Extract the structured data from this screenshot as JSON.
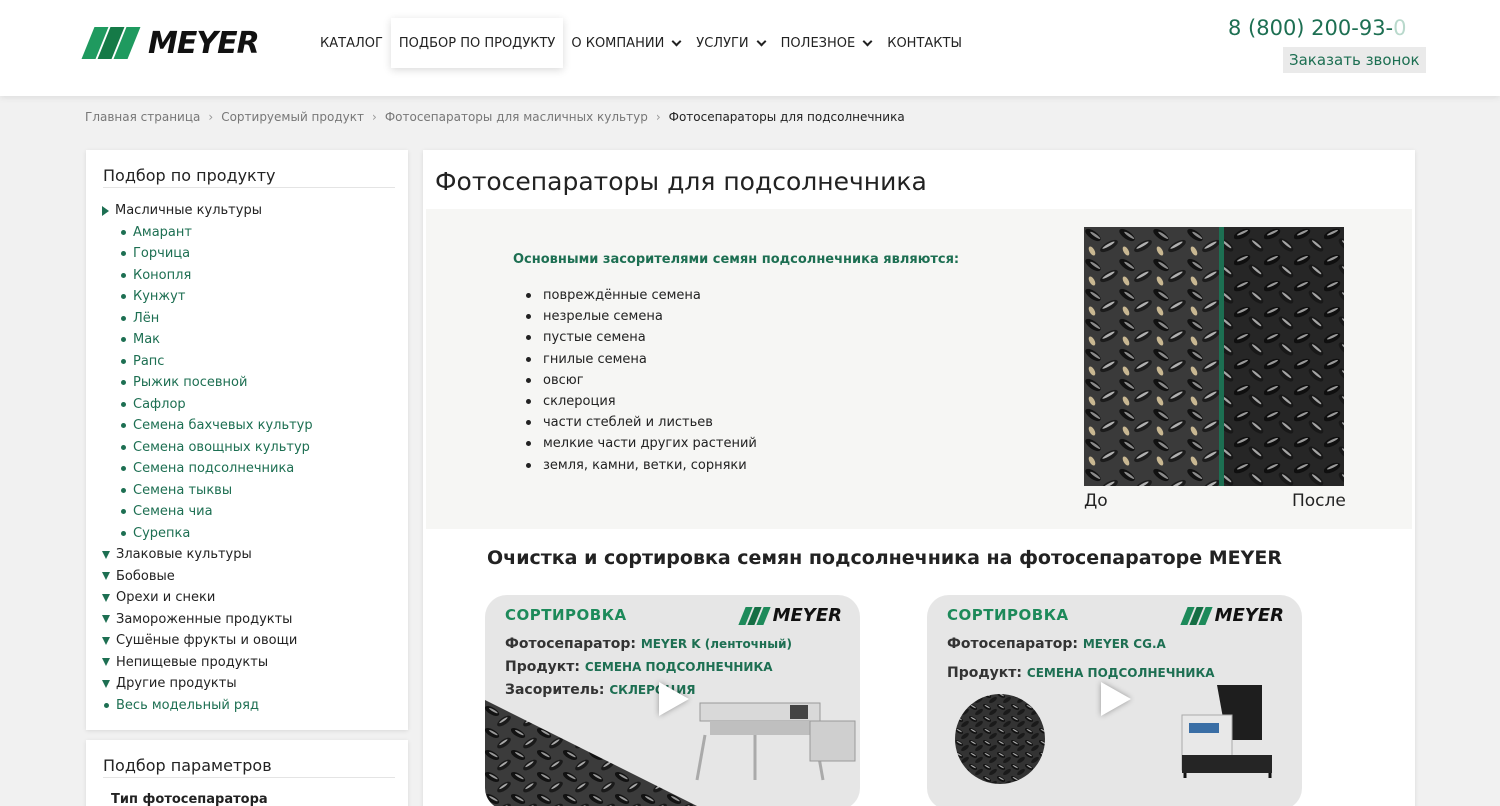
{
  "header": {
    "logo_text": "MEYER",
    "nav": [
      {
        "label": "КАТАЛОГ",
        "dropdown": false
      },
      {
        "label": "ПОДБОР ПО ПРОДУКТУ",
        "dropdown": false,
        "active": true
      },
      {
        "label": "О КОМПАНИИ",
        "dropdown": true
      },
      {
        "label": "УСЛУГИ",
        "dropdown": true
      },
      {
        "label": "ПОЛЕЗНОЕ",
        "dropdown": true
      },
      {
        "label": "КОНТАКТЫ",
        "dropdown": false
      }
    ],
    "phone_main": "8 (800) 200-93-",
    "phone_fade": "0",
    "callback_label": "Заказать звонок"
  },
  "breadcrumb": [
    "Главная страница",
    "Сортируемый продукт",
    "Фотосепараторы для масличных культур",
    "Фотосепараторы для подсолнечника"
  ],
  "sidebar": {
    "title": "Подбор по продукту",
    "open_category": "Масличные культуры",
    "subitems": [
      "Амарант",
      "Горчица",
      "Конопля",
      "Кунжут",
      "Лён",
      "Мак",
      "Рапс",
      "Рыжик посевной",
      "Сафлор",
      "Семена бахчевых культур",
      "Семена овощных культур",
      "Семена подсолнечника",
      "Семена тыквы",
      "Семена чиа",
      "Сурепка"
    ],
    "collapsed_categories": [
      "Злаковые культуры",
      "Бобовые",
      "Орехи и снеки",
      "Замороженные продукты",
      "Сушёные фрукты и овощи",
      "Непищевые продукты",
      "Другие продукты"
    ],
    "all_models": "Весь модельный ряд"
  },
  "params": {
    "title": "Подбор параметров",
    "subtitle": "Тип фотосепаратора"
  },
  "main": {
    "title": "Фотосепараторы для подсолнечника",
    "info_heading": "Основными засорителями семян подсолнечника являются:",
    "contaminants": [
      "повреждённые семена",
      "незрелые семена",
      "пустые семена",
      "гнилые семена",
      "овсюг",
      "склероция",
      "части стеблей и листьев",
      "мелкие части других растений",
      "земля, камни, ветки, сорняки"
    ],
    "label_before": "До",
    "label_after": "После",
    "section_title": "Очистка и сортировка семян подсолнечника на фотосепараторе MEYER"
  },
  "videos": [
    {
      "tag": "СОРТИРОВКА",
      "logo": "MEYER",
      "separator_label": "Фотосепаратор:",
      "separator_value": "MEYER K (ленточный)",
      "product_label": "Продукт:",
      "product_value": "СЕМЕНА ПОДСОЛНЕЧНИКА",
      "contaminant_label": "Засоритель:",
      "contaminant_value": "СКЛЕРОЦИЯ"
    },
    {
      "tag": "СОРТИРОВКА",
      "logo": "MEYER",
      "separator_label": "Фотосепаратор:",
      "separator_value": "MEYER CG.A",
      "product_label": "Продукт:",
      "product_value": "СЕМЕНА ПОДСОЛНЕЧНИКА"
    }
  ],
  "colors": {
    "brand_green": "#1d6f52",
    "accent_green": "#1d8a5a",
    "background": "#f1f1f1"
  }
}
